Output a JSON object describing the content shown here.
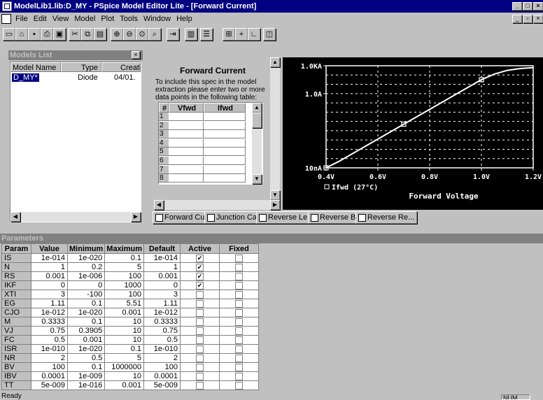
{
  "window": {
    "title": "ModelLib1.lib:D_MY - PSpice Model Editor Lite  - [Forward Current]"
  },
  "menu": [
    "File",
    "Edit",
    "View",
    "Model",
    "Plot",
    "Tools",
    "Window",
    "Help"
  ],
  "toolbar": {
    "buttons": [
      "new-icon",
      "open-icon",
      "save-icon",
      "print-icon",
      "print-preview-icon",
      "cut-icon",
      "copy-icon",
      "paste-icon",
      "zoom-in-icon",
      "zoom-out-icon",
      "zoom-fit-icon",
      "zoom-area-icon",
      "extract-icon",
      "split-view-icon",
      "tile-icon",
      "add-trace-icon",
      "crosshair-icon",
      "axis-icon",
      "log-icon"
    ]
  },
  "models_list": {
    "title": "Models List",
    "columns": [
      "Model Name",
      "Type",
      "Creatio"
    ],
    "rows": [
      {
        "name": "D_MY*",
        "type": "Diode",
        "created": "04/01."
      }
    ]
  },
  "spec": {
    "title": "Forward Current",
    "instructions": "To include this spec in the model extraction please enter two or more data points in the following table:",
    "columns": [
      "#",
      "Vfwd",
      "Ifwd"
    ],
    "rows": [
      "1",
      "2",
      "3",
      "4",
      "5",
      "6",
      "7",
      "8"
    ]
  },
  "chart_data": {
    "type": "line",
    "xlabel": "Forward Voltage",
    "ylabel": "",
    "x_ticks": [
      "0.4V",
      "0.6V",
      "0.8V",
      "1.0V",
      "1.2V"
    ],
    "y_ticks": [
      "10nA",
      "1.0A",
      "1.0KA"
    ],
    "xlim": [
      0.4,
      1.2
    ],
    "log_y": true,
    "grid": true,
    "legend": "bottom-left",
    "series": [
      {
        "name": "Ifwd (27°C)",
        "x": [
          0.4,
          0.45,
          0.5,
          0.55,
          0.6,
          0.65,
          0.7,
          0.75,
          0.8,
          0.85,
          0.9,
          0.95,
          1.0,
          1.05,
          1.1,
          1.15,
          1.2
        ],
        "y_log": [
          -8,
          -7.3,
          -6.5,
          -5.7,
          -4.9,
          -4.1,
          -3.3,
          -2.5,
          -1.7,
          -0.9,
          -0.1,
          0.7,
          1.5,
          2.1,
          2.5,
          2.7,
          2.8
        ],
        "markers_x": [
          0.4,
          0.7,
          1.0
        ]
      }
    ]
  },
  "tabs": [
    "Forward Cur...",
    "Junction Ca...",
    "Reverse Le...",
    "Reverse Br...",
    "Reverse Re..."
  ],
  "params": {
    "title": "Parameters",
    "columns": [
      "Param",
      "Value",
      "Minimum",
      "Maximum",
      "Default",
      "Active",
      "Fixed"
    ],
    "rows": [
      {
        "p": "IS",
        "v": "1e-014",
        "min": "1e-020",
        "max": "0.1",
        "def": "1e-014",
        "active": true,
        "fixed": false
      },
      {
        "p": "N",
        "v": "1",
        "min": "0.2",
        "max": "5",
        "def": "1",
        "active": true,
        "fixed": false
      },
      {
        "p": "RS",
        "v": "0.001",
        "min": "1e-006",
        "max": "100",
        "def": "0.001",
        "active": true,
        "fixed": false
      },
      {
        "p": "IKF",
        "v": "0",
        "min": "0",
        "max": "1000",
        "def": "0",
        "active": true,
        "fixed": false
      },
      {
        "p": "XTI",
        "v": "3",
        "min": "-100",
        "max": "100",
        "def": "3",
        "active": false,
        "fixed": false
      },
      {
        "p": "EG",
        "v": "1.11",
        "min": "0.1",
        "max": "5.51",
        "def": "1.11",
        "active": false,
        "fixed": false
      },
      {
        "p": "CJO",
        "v": "1e-012",
        "min": "1e-020",
        "max": "0.001",
        "def": "1e-012",
        "active": false,
        "fixed": false
      },
      {
        "p": "M",
        "v": "0.3333",
        "min": "0.1",
        "max": "10",
        "def": "0.3333",
        "active": false,
        "fixed": false
      },
      {
        "p": "VJ",
        "v": "0.75",
        "min": "0.3905",
        "max": "10",
        "def": "0.75",
        "active": false,
        "fixed": false
      },
      {
        "p": "FC",
        "v": "0.5",
        "min": "0.001",
        "max": "10",
        "def": "0.5",
        "active": false,
        "fixed": false
      },
      {
        "p": "ISR",
        "v": "1e-010",
        "min": "1e-020",
        "max": "0.1",
        "def": "1e-010",
        "active": false,
        "fixed": false
      },
      {
        "p": "NR",
        "v": "2",
        "min": "0.5",
        "max": "5",
        "def": "2",
        "active": false,
        "fixed": false
      },
      {
        "p": "BV",
        "v": "100",
        "min": "0.1",
        "max": "1000000",
        "def": "100",
        "active": false,
        "fixed": false
      },
      {
        "p": "IBV",
        "v": "0.0001",
        "min": "1e-009",
        "max": "10",
        "def": "0.0001",
        "active": false,
        "fixed": false
      },
      {
        "p": "TT",
        "v": "5e-009",
        "min": "1e-016",
        "max": "0.001",
        "def": "5e-009",
        "active": false,
        "fixed": false
      }
    ]
  },
  "status": {
    "left": "Ready",
    "num": "NUM"
  }
}
